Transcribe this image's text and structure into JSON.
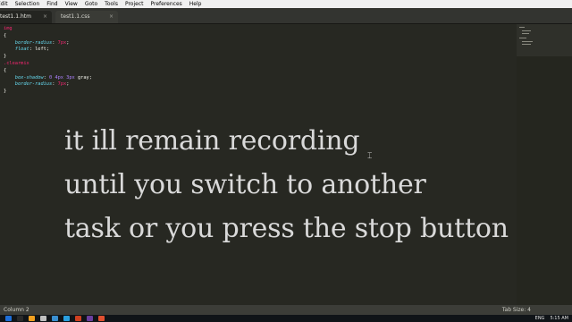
{
  "menu": [
    "Edit",
    "Selection",
    "Find",
    "View",
    "Goto",
    "Tools",
    "Project",
    "Preferences",
    "Help"
  ],
  "tabs": [
    {
      "label": "test1.1.htm",
      "close": "×"
    },
    {
      "label": "test1.1.css",
      "close": "×"
    }
  ],
  "code": {
    "line1": "img",
    "line2": "{",
    "line3_prop": "border-radius",
    "line3_val": "7px",
    "line4_prop": "float",
    "line4_val": "left",
    "line5": "}",
    "line6": ".clearmix",
    "line7": "{",
    "line8_prop": "box-shadow",
    "line8_val1": "0 4px 3px",
    "line8_val2": "gray",
    "line9_prop": "border-radius",
    "line9_val": "7px",
    "line10": "}"
  },
  "caption": {
    "line1": "it ill remain recording",
    "line2": "until you switch to another",
    "line3": "task or you press the stop button"
  },
  "status": {
    "left": "Column 2",
    "right": "Tab Size: 4"
  },
  "taskbar": {
    "lang": "ENG",
    "time": "5:15 AM",
    "icon_colors": [
      "#1e6fd9",
      "#2a2a2a",
      "#f0a020",
      "#c0c0c0",
      "#3a8fd0",
      "#2aa0e0",
      "#d04020",
      "#6b3fa0",
      "#e05030"
    ]
  }
}
